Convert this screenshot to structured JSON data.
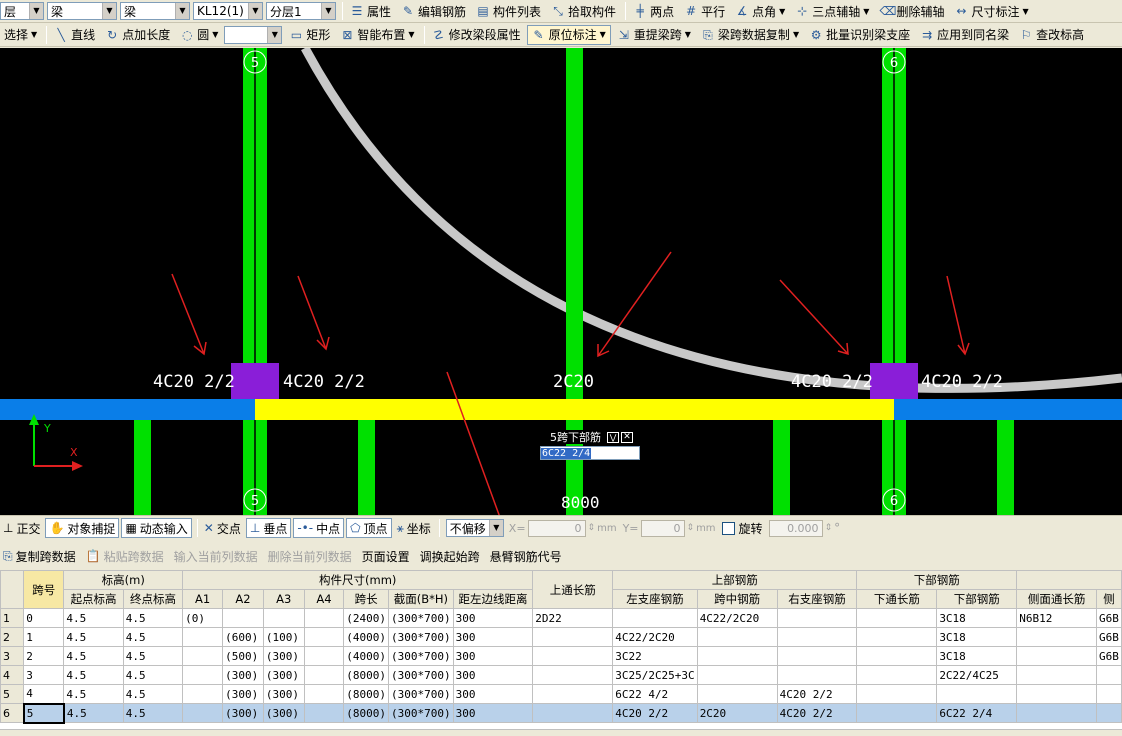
{
  "toolbar1": {
    "floor_select": "层",
    "type_select": "梁",
    "subtype_select": "梁",
    "member_select": "KL12(1)",
    "layer_select": "分层1",
    "attr_label": "属性",
    "edit_rebar_label": "编辑钢筋",
    "member_list_label": "构件列表",
    "pick_member_label": "拾取构件",
    "two_point_label": "两点",
    "parallel_label": "平行",
    "point_angle_label": "点角",
    "three_point_aux_label": "三点辅轴",
    "delete_aux_label": "删除辅轴",
    "dim_label": "尺寸标注"
  },
  "toolbar2": {
    "select_label": "选择",
    "line_label": "直线",
    "point_length_label": "点加长度",
    "circle_label": "圆",
    "rect_label": "矩形",
    "smart_layout_label": "智能布置",
    "modify_segment_label": "修改梁段属性",
    "in_place_label": "原位标注",
    "repick_span_label": "重提梁跨",
    "copy_span_data_label": "梁跨数据复制",
    "batch_identify_label": "批量识别梁支座",
    "apply_same_name_label": "应用到同名梁",
    "check_elev_label": "查改标高"
  },
  "canvas": {
    "axis_labels": [
      "5",
      "6",
      "5",
      "6"
    ],
    "annotations": [
      "4C20 2/2",
      "4C20 2/2",
      "2C20",
      "4C20 2/2",
      "4C20 2/2"
    ],
    "dimension_text": "8000",
    "popup_title": "5跨下部筋",
    "popup_value": "6C22 2/4",
    "colors": {
      "background": "#000000",
      "column": "#00e000",
      "beam_blue": "#0a7ee8",
      "beam_yellow": "#ffff00",
      "support": "#8a1ed8",
      "arc": "#c8c8c8",
      "arrow": "#e02020"
    }
  },
  "statusbar": {
    "ortho_label": "正交",
    "snap_label": "对象捕捉",
    "dynamic_input_label": "动态输入",
    "intersect_label": "交点",
    "perp_label": "垂点",
    "mid_label": "中点",
    "vertex_label": "顶点",
    "coord_label": "坐标",
    "offset_select": "不偏移",
    "x_label": "X=",
    "x_value": "0",
    "y_label": "Y=",
    "y_value": "0",
    "unit": "mm",
    "rotate_label": "旋转",
    "rotate_value": "0.000",
    "degree": "°"
  },
  "table_toolbar": {
    "copy_span": "复制跨数据",
    "paste_span": "粘贴跨数据",
    "input_col": "输入当前列数据",
    "delete_col": "删除当前列数据",
    "page_setup": "页面设置",
    "adjust_start": "调换起始跨",
    "cantilever": "悬臂钢筋代号"
  },
  "table": {
    "header_top": {
      "span_no": "跨号",
      "elevation": "标高(m)",
      "member_size": "构件尺寸(mm)",
      "top_through": "上通长筋",
      "top_rebar": "上部钢筋",
      "bottom_rebar": "下部钢筋"
    },
    "header_sub": [
      "起点标高",
      "终点标高",
      "A1",
      "A2",
      "A3",
      "A4",
      "跨长",
      "截面(B*H)",
      "距左边线距离",
      "左支座钢筋",
      "跨中钢筋",
      "右支座钢筋",
      "下通长筋",
      "下部钢筋",
      "侧面通长筋",
      "侧"
    ],
    "rows": [
      [
        "1",
        "0",
        "4.5",
        "4.5",
        "(0)",
        "",
        "",
        "",
        "(2400)",
        "(300*700)",
        "300",
        "2D22",
        "",
        "4C22/2C20",
        "",
        "",
        "3C18",
        "N6B12",
        "G6B"
      ],
      [
        "2",
        "1",
        "4.5",
        "4.5",
        "",
        "(600)",
        "(100)",
        "",
        "(4000)",
        "(300*700)",
        "300",
        "",
        "4C22/2C20",
        "",
        "",
        "",
        "3C18",
        "",
        "G6B"
      ],
      [
        "3",
        "2",
        "4.5",
        "4.5",
        "",
        "(500)",
        "(300)",
        "",
        "(4000)",
        "(300*700)",
        "300",
        "",
        "3C22",
        "",
        "",
        "",
        "3C18",
        "",
        "G6B"
      ],
      [
        "4",
        "3",
        "4.5",
        "4.5",
        "",
        "(300)",
        "(300)",
        "",
        "(8000)",
        "(300*700)",
        "300",
        "",
        "3C25/2C25+3C",
        "",
        "",
        "",
        "2C22/4C25",
        "",
        ""
      ],
      [
        "5",
        "4",
        "4.5",
        "4.5",
        "",
        "(300)",
        "(300)",
        "",
        "(8000)",
        "(300*700)",
        "300",
        "",
        "6C22 4/2",
        "",
        "4C20 2/2",
        "",
        "",
        "",
        ""
      ],
      [
        "6",
        "5",
        "4.5",
        "4.5",
        "",
        "(300)",
        "(300)",
        "",
        "(8000)",
        "(300*700)",
        "300",
        "",
        "4C20 2/2",
        "2C20",
        "4C20 2/2",
        "",
        "6C22 2/4",
        "",
        ""
      ]
    ]
  }
}
